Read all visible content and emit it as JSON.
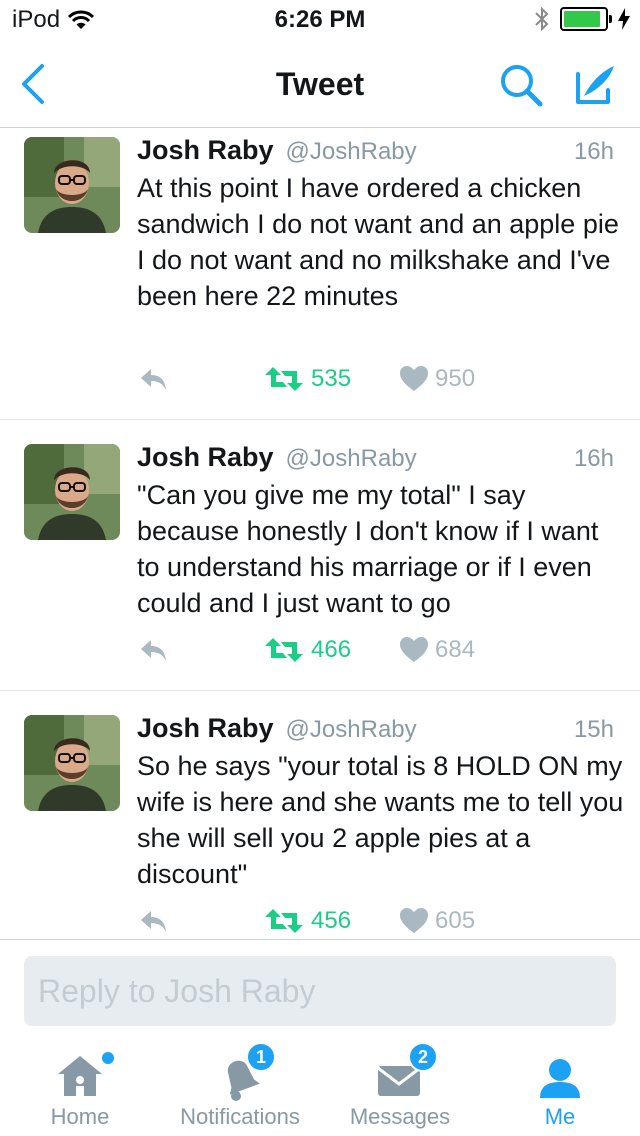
{
  "status": {
    "carrier": "iPod",
    "time": "6:26 PM",
    "battery_level": 0.9
  },
  "nav": {
    "title": "Tweet"
  },
  "tweets": [
    {
      "name": "Josh Raby",
      "handle": "@JoshRaby",
      "time": "16h",
      "text": "At this point I have ordered a chicken sandwich I do not want and an apple pie I do not want and no milkshake and I've been here 22 minutes",
      "retweets": "535",
      "likes": "950"
    },
    {
      "name": "Josh Raby",
      "handle": "@JoshRaby",
      "time": "16h",
      "text": "\"Can you give me my total\" I say because honestly I don't know if I want to understand his marriage or if I even could and I just want to go",
      "retweets": "466",
      "likes": "684"
    },
    {
      "name": "Josh Raby",
      "handle": "@JoshRaby",
      "time": "15h",
      "text": "So he says \"your total is 8 HOLD ON my wife is here and she wants me to tell you she will sell you 2 apple pies at a discount\"",
      "retweets": "456",
      "likes": "605"
    }
  ],
  "reply": {
    "placeholder": "Reply to Josh Raby"
  },
  "tabs": [
    {
      "label": "Home",
      "icon": "home-icon"
    },
    {
      "label": "Notifications",
      "icon": "bell-icon",
      "badge": "1"
    },
    {
      "label": "Messages",
      "icon": "envelope-icon",
      "badge": "2"
    },
    {
      "label": "Me",
      "icon": "person-icon",
      "active": true
    }
  ],
  "colors": {
    "accent": "#1da1f2",
    "retweet": "#19cf86",
    "muted": "#8899a6"
  }
}
